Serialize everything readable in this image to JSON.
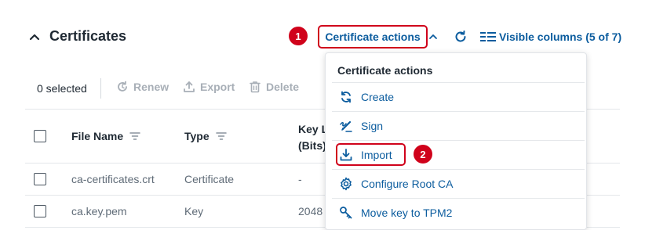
{
  "section": {
    "title": "Certificates"
  },
  "annotations": {
    "step1": "1",
    "step2": "2"
  },
  "header_actions": {
    "certificate_actions_label": "Certificate actions",
    "visible_columns_label": "Visible columns (5 of 7)"
  },
  "toolbar": {
    "selected_count": "0 selected",
    "renew_label": "Renew",
    "export_label": "Export",
    "delete_label": "Delete"
  },
  "table": {
    "columns": [
      "File Name",
      "Type",
      "Key L",
      "(Bits)"
    ],
    "rows": [
      {
        "file_name": "ca-certificates.crt",
        "type": "Certificate",
        "key_length": "-"
      },
      {
        "file_name": "ca.key.pem",
        "type": "Key",
        "key_length": "2048"
      }
    ]
  },
  "dropdown": {
    "header": "Certificate actions",
    "items": [
      {
        "label": "Create",
        "icon": "refresh-arrows-icon"
      },
      {
        "label": "Sign",
        "icon": "signature-pen-icon"
      },
      {
        "label": "Import",
        "icon": "download-icon"
      },
      {
        "label": "Configure Root CA",
        "icon": "gear-icon"
      },
      {
        "label": "Move key to TPM2",
        "icon": "key-icon"
      }
    ]
  },
  "colors": {
    "accent": "#0b5c9e",
    "highlight": "#d0021b",
    "disabled": "#a8afb7",
    "text": "#1f2933",
    "muted": "#5f6b77"
  }
}
